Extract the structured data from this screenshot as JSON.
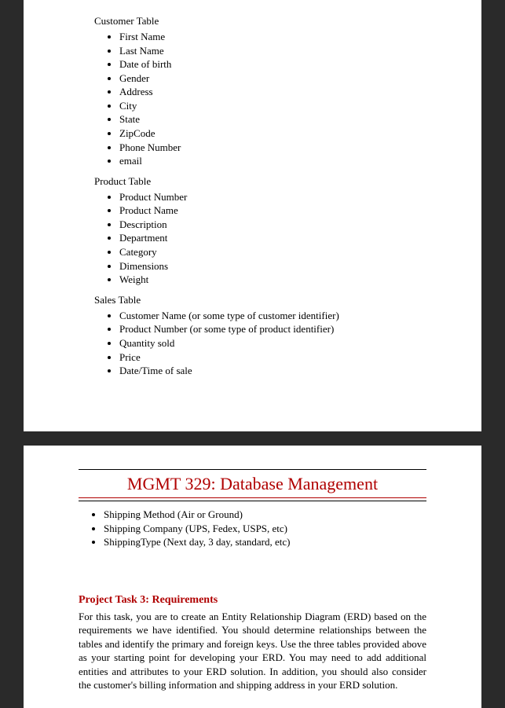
{
  "page1": {
    "tables": [
      {
        "title": "Customer Table",
        "items": [
          "First Name",
          "Last Name",
          "Date of birth",
          "Gender",
          "Address",
          "City",
          "State",
          "ZipCode",
          "Phone Number",
          "email"
        ]
      },
      {
        "title": "Product Table",
        "items": [
          "Product Number",
          "Product Name",
          "Description",
          "Department",
          "Category",
          "Dimensions",
          "Weight"
        ]
      },
      {
        "title": "Sales Table",
        "items": [
          "Customer Name (or some type of customer identifier)",
          "Product Number (or some type of product identifier)",
          "Quantity sold",
          "Price",
          "Date/Time of sale"
        ]
      }
    ]
  },
  "page2": {
    "header": "MGMT 329: Database Management",
    "continuedList": [
      "Shipping Method (Air or Ground)",
      "Shipping Company (UPS, Fedex, USPS, etc)",
      "ShippingType (Next day, 3 day, standard, etc)"
    ],
    "sectionTitle": "Project Task 3: Requirements",
    "bodyText": "For this task, you are to create an Entity Relationship Diagram (ERD) based on the requirements we have identified. You should determine relationships between the tables and identify the primary and foreign keys. Use the three tables provided above as your starting point for developing your ERD. You may need to add additional entities and attributes to your ERD solution. In addition, you should also consider the customer's billing information and shipping address in your ERD solution."
  }
}
